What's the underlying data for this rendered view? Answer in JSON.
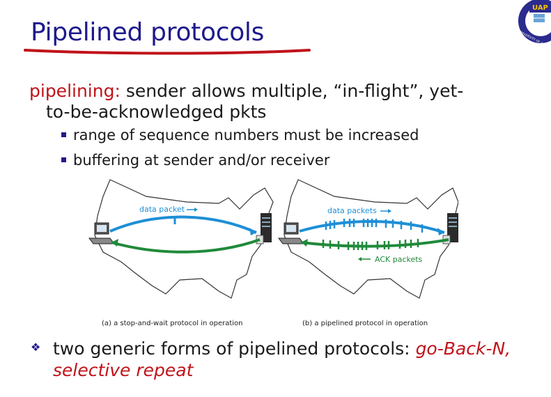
{
  "slide": {
    "title": "Pipelined protocols",
    "logo_text": "UAP",
    "logo_ring_text": "UNIVERSITY OF ASIA PACIFIC",
    "pipelining_label": "pipelining:",
    "pipelining_text": " sender allows multiple, “in-flight”, yet-",
    "pipelining_text2": "to-be-acknowledged pkts",
    "bullets": [
      "range of sequence numbers must be increased",
      "buffering at sender and/or receiver"
    ],
    "figure": {
      "left_label": "data packet",
      "right_label_top": "data packets",
      "right_label_bottom": "ACK packets",
      "caption_a": "(a) a stop-and-wait protocol in operation",
      "caption_b": "(b) a pipelined protocol in operation"
    },
    "final_text": "two generic forms of pipelined protocols: ",
    "final_em": "go-Back-N,",
    "final_em2": "selective repeat",
    "colors": {
      "title": "#1f1a8c",
      "accent": "#c0131a",
      "arrow_blue": "#1e8fd6",
      "arrow_green": "#1f8a3a"
    }
  }
}
